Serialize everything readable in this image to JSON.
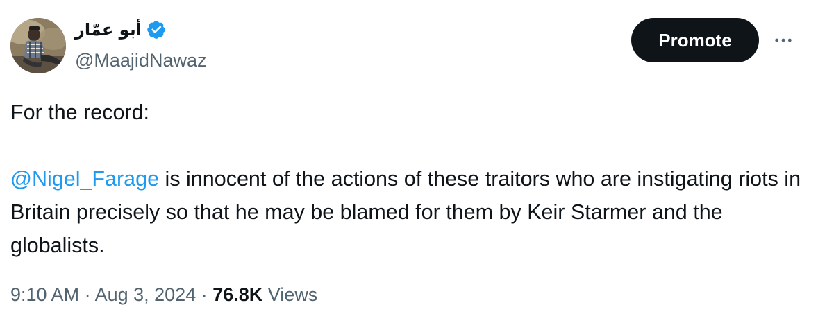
{
  "author": {
    "display_name": "أبو عمّار",
    "handle": "@MaajidNawaz",
    "avatar_icon": "profile-photo",
    "verified_icon": "verified-badge-icon",
    "verified_color": "#1d9bf0"
  },
  "actions": {
    "promote_label": "Promote",
    "more_icon": "more-options-icon"
  },
  "tweet": {
    "line1": "For the record:",
    "mention": "@Nigel_Farage",
    "body": " is innocent of the actions of these traitors who are instigating riots in Britain precisely so that he may be blamed for them by Keir Starmer and the globalists."
  },
  "meta": {
    "time": "9:10 AM",
    "separator": " · ",
    "date": "Aug 3, 2024",
    "views_count": "76.8K",
    "views_label": " Views"
  },
  "colors": {
    "text": "#0f1419",
    "secondary": "#536471",
    "link": "#1d9bf0",
    "button_bg": "#0f1419"
  }
}
